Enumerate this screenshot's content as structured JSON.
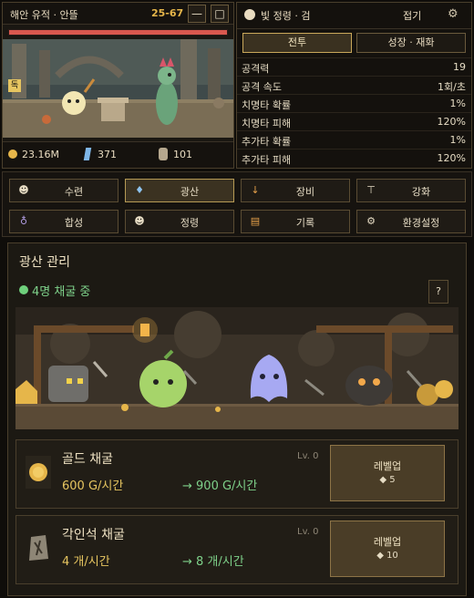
{
  "game": {
    "title": "해안 유적 · 안뜰",
    "stage": "25-67",
    "hp_fraction": 1.0,
    "buttons": {
      "minimize": "—",
      "maximize": "□"
    },
    "resources": {
      "gold": "23.16M",
      "crystal": "371",
      "stone": "101"
    },
    "side_badge": "독"
  },
  "spirit": {
    "title": "빛 정령 · 검",
    "collapse": "접기",
    "tabs": [
      {
        "label": "전투",
        "active": true
      },
      {
        "label": "성장 · 재화",
        "active": false
      }
    ],
    "stats": [
      {
        "label": "공격력",
        "value": "19"
      },
      {
        "label": "공격 속도",
        "value": "1회/초"
      },
      {
        "label": "치명타 확률",
        "value": "1%"
      },
      {
        "label": "치명타 피해",
        "value": "120%"
      },
      {
        "label": "추가타 확률",
        "value": "1%"
      },
      {
        "label": "추가타 피해",
        "value": "120%"
      }
    ]
  },
  "nav": [
    {
      "label": "수련",
      "icon": "training-icon",
      "active": false
    },
    {
      "label": "광산",
      "icon": "crystal-icon",
      "active": true
    },
    {
      "label": "장비",
      "icon": "torch-icon",
      "active": false
    },
    {
      "label": "강화",
      "icon": "anvil-icon",
      "active": false
    },
    {
      "label": "합성",
      "icon": "potion-icon",
      "active": false
    },
    {
      "label": "정령",
      "icon": "spirit-icon",
      "active": false
    },
    {
      "label": "기록",
      "icon": "book-icon",
      "active": false
    },
    {
      "label": "환경설정",
      "icon": "gear-icon",
      "active": false
    }
  ],
  "mine": {
    "title": "광산 관리",
    "status": "4명 채굴 중",
    "help": "?",
    "upgrades": [
      {
        "name": "골드 채굴",
        "level": "Lv. 0",
        "current": "600 G/시간",
        "next": "→ 900 G/시간",
        "button": "레벨업",
        "cost": "◆ 5",
        "icon": "gold-coin-icon"
      },
      {
        "name": "각인석 채굴",
        "level": "Lv. 0",
        "current": "4 개/시간",
        "next": "→ 8 개/시간",
        "button": "레벨업",
        "cost": "◆ 10",
        "icon": "rune-stone-icon"
      }
    ]
  },
  "colors": {
    "accent": "#c9a85a",
    "gold": "#e6c560",
    "green": "#7ed18a",
    "hp": "#d9584f"
  }
}
